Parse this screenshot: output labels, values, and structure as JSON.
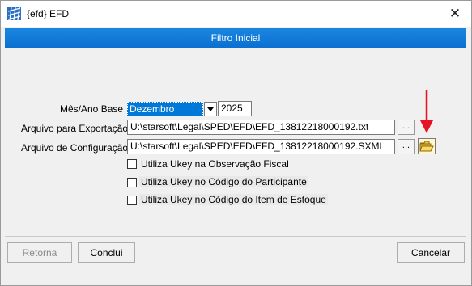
{
  "window": {
    "title": "{efd}  EFD",
    "close_symbol": "✕"
  },
  "header": {
    "title": "Filtro Inicial"
  },
  "form": {
    "month_year_label": "Mês/Ano Base",
    "month_value": "Dezembro",
    "year_value": "2025",
    "export_label": "Arquivo para Exportação",
    "export_path": "U:\\starsoft\\Legal\\SPED\\EFD\\EFD_13812218000192.txt",
    "config_label": "Arquivo de Configuração",
    "config_path": "U:\\starsoft\\Legal\\SPED\\EFD\\EFD_13812218000192.SXML",
    "browse_label": "...",
    "checkboxes": [
      {
        "label": "Utiliza Ukey na Observação Fiscal",
        "checked": false
      },
      {
        "label": "Utiliza Ukey no Código do Participante",
        "checked": false
      },
      {
        "label": "Utiliza Ukey no Código do Item de Estoque",
        "checked": false
      }
    ]
  },
  "footer": {
    "back_label": "Retorna",
    "finish_label": "Conclui",
    "cancel_label": "Cancelar"
  },
  "colors": {
    "accent": "#0078d7",
    "annotation_arrow": "#e81123"
  },
  "icons": {
    "app": "grid-app-icon",
    "folder": "folder-open-icon",
    "arrow": "red-arrow-annotation-icon"
  }
}
